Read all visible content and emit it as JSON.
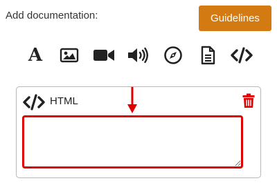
{
  "header": {
    "label": "Add documentation:",
    "guidelines_button": "Guidelines"
  },
  "toolbar": {
    "items": [
      {
        "name": "text",
        "glyph": "A",
        "icon": "text-icon"
      },
      {
        "name": "image",
        "icon": "image-icon"
      },
      {
        "name": "video",
        "icon": "video-camera-icon"
      },
      {
        "name": "audio",
        "icon": "speaker-icon"
      },
      {
        "name": "link",
        "icon": "compass-icon"
      },
      {
        "name": "file",
        "icon": "document-icon"
      },
      {
        "name": "html",
        "icon": "code-icon"
      }
    ]
  },
  "html_block": {
    "title": "HTML",
    "icon": "code-icon",
    "delete_icon": "trash-icon",
    "editor_value": ""
  },
  "colors": {
    "accent": "#d47a12",
    "highlight": "#e00000",
    "delete": "#e00000"
  }
}
